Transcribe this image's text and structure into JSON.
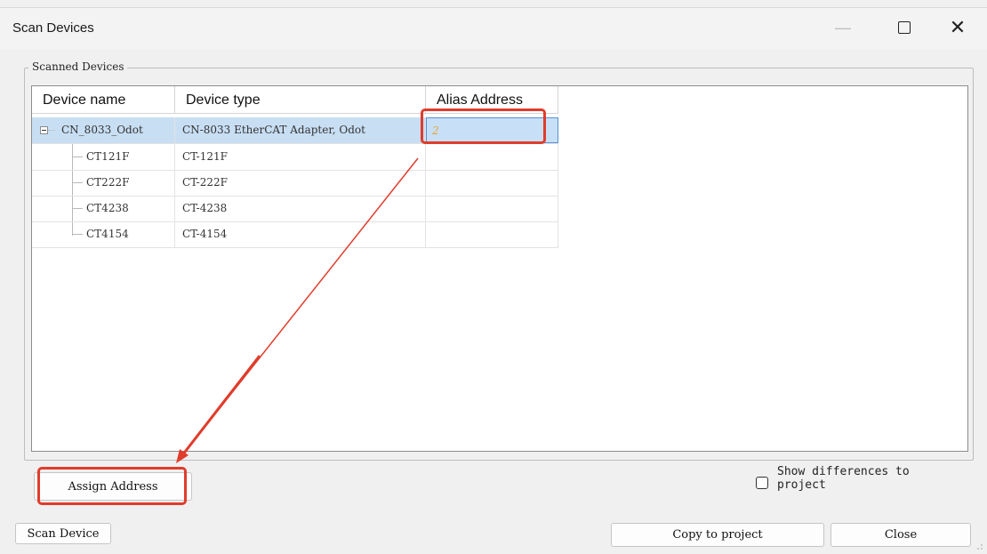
{
  "window": {
    "title": "Scan Devices"
  },
  "titlebar_icons": {
    "minimize": "minimize-icon",
    "maximize": "maximize-icon",
    "close": "close-icon"
  },
  "group": {
    "label": "Scanned Devices"
  },
  "table": {
    "columns": [
      "Device name",
      "Device type",
      "Alias Address"
    ],
    "rows": [
      {
        "name": "CN_8033_Odot",
        "type": "CN-8033 EtherCAT Adapter, Odot",
        "alias": "2"
      },
      {
        "name": "CT121F",
        "type": "CT-121F",
        "alias": ""
      },
      {
        "name": "CT222F",
        "type": "CT-222F",
        "alias": ""
      },
      {
        "name": "CT4238",
        "type": "CT-4238",
        "alias": ""
      },
      {
        "name": "CT4154",
        "type": "CT-4154",
        "alias": ""
      }
    ]
  },
  "buttons": {
    "assign_address": "Assign Address",
    "scan_device": "Scan Device",
    "copy_to_project": "Copy to project",
    "close": "Close"
  },
  "checkbox": {
    "label_line1": "Show differences to",
    "label_line2": "project",
    "checked": false
  },
  "colors": {
    "annotation": "#e03c2c",
    "selection": "#c8def3",
    "alias_text": "#e8a33a"
  }
}
